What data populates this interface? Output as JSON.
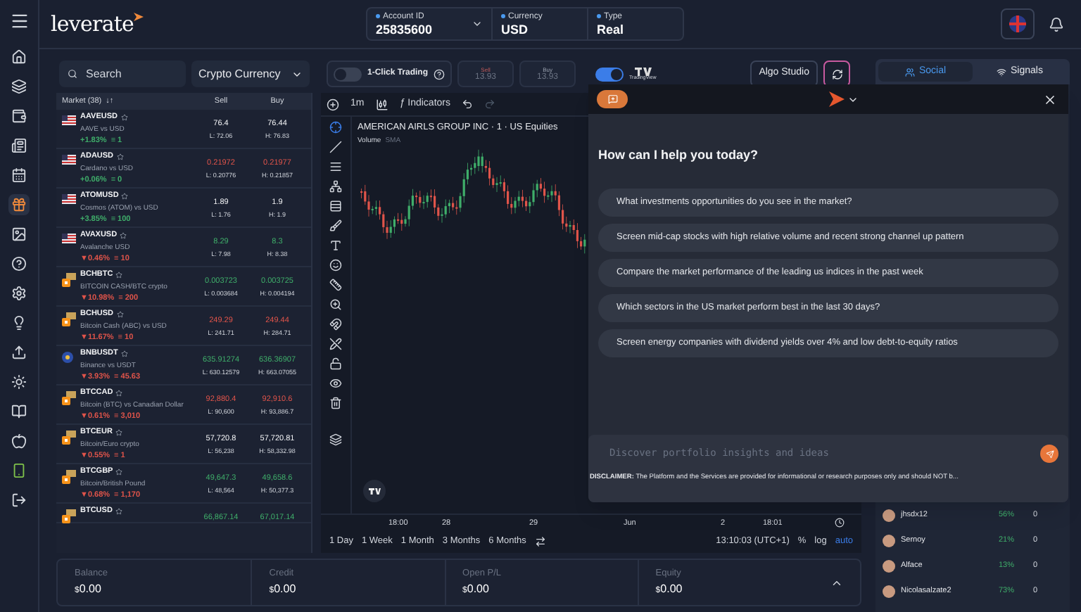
{
  "brand": "leverate",
  "header": {
    "fields": [
      {
        "label": "Account ID",
        "value": "25835600",
        "dropdown": true
      },
      {
        "label": "Currency",
        "value": "USD",
        "dropdown": false
      },
      {
        "label": "Type",
        "value": "Real",
        "dropdown": false
      }
    ]
  },
  "sidebar": {
    "items": [
      {
        "selected": false
      },
      {
        "selected": false
      },
      {
        "selected": false
      },
      {
        "selected": false
      },
      {
        "selected": false
      },
      {
        "selected": true
      },
      {
        "selected": false
      },
      {
        "selected": false
      },
      {
        "selected": false
      },
      {
        "selected": false
      },
      {
        "selected": false
      },
      {
        "selected": false
      },
      {
        "selected": false
      },
      {
        "selected": false
      },
      {
        "selected": false
      },
      {
        "selected": false
      }
    ]
  },
  "market": {
    "search_placeholder": "Search",
    "category": "Crypto Currency",
    "header": {
      "market": "Market (38)",
      "sort": "↓↑",
      "sell": "Sell",
      "buy": "Buy"
    },
    "rows": [
      {
        "kind": "fiat",
        "symbol": "AAVEUSD",
        "description": "AAVE vs USD",
        "change": {
          "value": "+1.83%",
          "count": "≡ 1",
          "color": "#3fae6a"
        },
        "quote": {
          "sell": "76.4",
          "low": "L: 72.06",
          "buy": "76.44",
          "high": "H: 76.83",
          "color": "#f3f4f6"
        }
      },
      {
        "kind": "fiat",
        "symbol": "ADAUSD",
        "description": "Cardano vs USD",
        "change": {
          "value": "+0.06%",
          "count": "≡ 0",
          "color": "#3fae6a"
        },
        "quote": {
          "sell": "0.21972",
          "low": "L: 0.20776",
          "buy": "0.21977",
          "high": "H: 0.21857",
          "color": "#e0544a"
        }
      },
      {
        "kind": "fiat",
        "symbol": "ATOMUSD",
        "description": "Cosmos (ATOM) vs USD",
        "change": {
          "value": "+3.85%",
          "count": "≡ 100",
          "color": "#3fae6a"
        },
        "quote": {
          "sell": "1.89",
          "low": "L: 1.76",
          "buy": "1.9",
          "high": "H: 1.9",
          "color": "#f3f4f6"
        }
      },
      {
        "kind": "fiat",
        "symbol": "AVAXUSD",
        "description": "Avalanche USD",
        "change": {
          "value": "▼0.46%",
          "count": "≡ 10",
          "color": "#e0544a"
        },
        "quote": {
          "sell": "8.29",
          "low": "L: 7.98",
          "buy": "8.3",
          "high": "H: 8.38",
          "color": "#3fae6a"
        }
      },
      {
        "kind": "crypto",
        "symbol": "BCHBTC",
        "description": "BITCOIN CASH/BTC crypto",
        "change": {
          "value": "▼10.98%",
          "count": "≡ 200",
          "color": "#e0544a"
        },
        "quote": {
          "sell": "0.003723",
          "low": "L: 0.003684",
          "buy": "0.003725",
          "high": "H: 0.004194",
          "color": "#3fae6a"
        }
      },
      {
        "kind": "crypto",
        "symbol": "BCHUSD",
        "description": "Bitcoin Cash (ABC) vs USD",
        "change": {
          "value": "▼11.67%",
          "count": "≡ 10",
          "color": "#e0544a"
        },
        "quote": {
          "sell": "249.29",
          "low": "L: 241.71",
          "buy": "249.44",
          "high": "H: 284.71",
          "color": "#e0544a"
        }
      },
      {
        "kind": "coin",
        "symbol": "BNBUSDT",
        "description": "Binance vs USDT",
        "change": {
          "value": "▼3.93%",
          "count": "≡ 45.63",
          "color": "#e0544a"
        },
        "quote": {
          "sell": "635.91274",
          "low": "L: 630.12579",
          "buy": "636.36907",
          "high": "H: 663.07055",
          "color": "#3fae6a"
        }
      },
      {
        "kind": "crypto",
        "symbol": "BTCCAD",
        "description": "Bitcoin (BTC) vs Canadian Dollar",
        "change": {
          "value": "▼0.61%",
          "count": "≡ 3,010",
          "color": "#e0544a"
        },
        "quote": {
          "sell": "92,880.4",
          "low": "L: 90,600",
          "buy": "92,910.6",
          "high": "H: 93,886.7",
          "color": "#e0544a"
        }
      },
      {
        "kind": "crypto",
        "symbol": "BTCEUR",
        "description": "Bitcoin/Euro crypto",
        "change": {
          "value": "▼0.55%",
          "count": "≡ 1",
          "color": "#e0544a"
        },
        "quote": {
          "sell": "57,720.8",
          "low": "L: 56,238",
          "buy": "57,720.81",
          "high": "H: 58,332.98",
          "color": "#f3f4f6"
        }
      },
      {
        "kind": "crypto",
        "symbol": "BTCGBP",
        "description": "Bitcoin/British Pound",
        "change": {
          "value": "▼0.68%",
          "count": "≡ 1,170",
          "color": "#e0544a"
        },
        "quote": {
          "sell": "49,647.3",
          "low": "L: 48,564",
          "buy": "49,658.6",
          "high": "H: 50,377.3",
          "color": "#3fae6a"
        }
      },
      {
        "kind": "crypto",
        "symbol": "BTCUSD",
        "quote": {
          "sell": "66,867.14",
          "buy": "67,017.14",
          "color": "#3fae6a"
        }
      }
    ]
  },
  "trading": {
    "one_click": {
      "label": "1-Click Trading",
      "on": false
    },
    "sell": {
      "label": "Sell",
      "price": "13.93"
    },
    "buy": {
      "label": "Buy",
      "price": "13.93"
    },
    "tradingview": {
      "label": "TradingView",
      "on": true
    },
    "algo_studio": "Algo Studio"
  },
  "panel_tabs": [
    {
      "label": "Social",
      "selected": true
    },
    {
      "label": "Signals",
      "selected": false
    }
  ],
  "chart": {
    "interval": "1m",
    "indicators": "Indicators",
    "indicators_symbol": "ƒ",
    "title": "AMERICAN AIRLS GROUP INC · 1 · US Equities",
    "legend": {
      "name": "Volume",
      "indicator": "SMA"
    },
    "x_labels": [
      "18:00",
      "28",
      "29",
      "Jun",
      "2",
      "18:01"
    ],
    "ranges": [
      "1 Day",
      "1 Week",
      "1 Month",
      "3 Months",
      "6 Months"
    ],
    "clock": "13:10:03 (UTC+1)",
    "scale": [
      {
        "label": "%",
        "selected": false
      },
      {
        "label": "log",
        "selected": false
      },
      {
        "label": "auto",
        "selected": true
      }
    ]
  },
  "assistant": {
    "greeting": "How can I help you today?",
    "suggestions": [
      "What investments opportunities do you see in the market?",
      "Screen mid-cap stocks with high relative volume and recent strong channel up pattern",
      "Compare the market performance of the leading us indices in the past week",
      "Which sectors in the US market perform best in the last 30 days?",
      "Screen energy companies with dividend yields over 4% and low debt-to-equity ratios"
    ],
    "placeholder": "Discover portfolio insights and ideas",
    "disclaimer": "**DISCLAIMER:** The Platform and the Services are provided for informational or research purposes only and should NOT b..."
  },
  "traders": [
    {
      "name": "jhsdx12",
      "share": "56%",
      "value": "0"
    },
    {
      "name": "Sernoy",
      "share": "21%",
      "value": "0"
    },
    {
      "name": "Alface",
      "share": "13%",
      "value": "0"
    },
    {
      "name": "Nicolasalzate2",
      "share": "73%",
      "value": "0"
    }
  ],
  "balance": [
    {
      "label": "Balance",
      "currency": "$",
      "amount": "0.00"
    },
    {
      "label": "Credit",
      "currency": "$",
      "amount": "0.00"
    },
    {
      "label": "Open P/L",
      "currency": "$",
      "amount": "0.00"
    },
    {
      "label": "Equity",
      "currency": "$",
      "amount": "0.00"
    }
  ]
}
